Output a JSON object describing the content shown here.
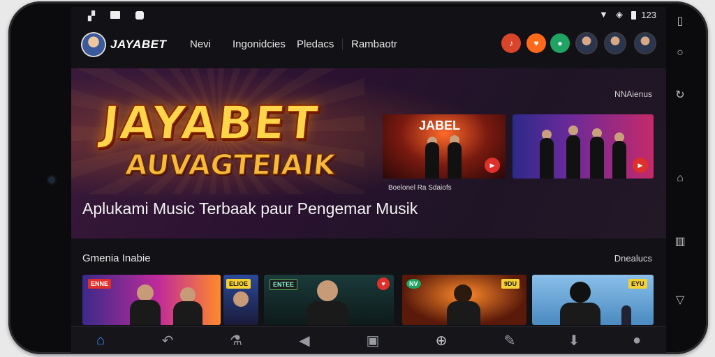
{
  "status": {
    "time": "123"
  },
  "header": {
    "brand": "JAYABET",
    "nav": [
      "Nevi",
      "Ingonidcies",
      "Pledacs",
      "Rambaotr"
    ]
  },
  "hero": {
    "logo_line1": "JAYABET",
    "logo_line2": "AUVAGTEIAIK",
    "more_label": "NNAienus",
    "thumb1_title": "JABEL",
    "thumb_caption": "Boelonel Ra Sdaiofs",
    "tagline": "Aplukami Music Terbaak paur Pengemar Musik"
  },
  "section": {
    "title": "Gmenia Inabie",
    "more_label": "Dnealucs",
    "cards": [
      {
        "badge": "ENNE"
      },
      {
        "badge": "ELIOE"
      },
      {
        "badge": "ENTEE"
      },
      {
        "badge": "NV"
      },
      {
        "badge": "9DU"
      },
      {
        "badge": "EYU"
      }
    ]
  },
  "icons": {
    "status": [
      "gallery-icon",
      "square-icon",
      "app-icon",
      "wifi-icon",
      "signal-icon",
      "battery-icon"
    ],
    "bottom_nav": [
      "home-icon",
      "back-arrow-icon",
      "flask-icon",
      "send-icon",
      "media-icon",
      "gift-icon",
      "edit-icon",
      "download-icon",
      "profile-icon"
    ],
    "system_bar": [
      "recent-apps-icon",
      "home-circle-icon",
      "rotate-icon",
      "bell-icon",
      "book-icon",
      "back-triangle-icon"
    ]
  },
  "colors": {
    "accent": "#3a8dff",
    "live_red": "#e0302a",
    "badge_yellow": "#f5d033"
  }
}
